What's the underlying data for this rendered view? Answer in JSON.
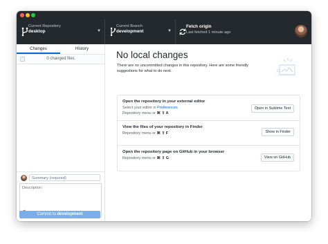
{
  "toolbar": {
    "repo_label": "Current Repository",
    "repo_name": "desktop",
    "branch_label": "Current Branch",
    "branch_name": "development",
    "fetch_title": "Fetch origin",
    "fetch_sub": "Last fetched 1 minute ago"
  },
  "sidebar": {
    "tabs": [
      {
        "label": "Changes"
      },
      {
        "label": "History"
      }
    ],
    "changed_files": "0 changed files"
  },
  "commit": {
    "summary_placeholder": "Summary (required)",
    "description_placeholder": "Description",
    "button_prefix": "Commit to ",
    "button_branch": "development"
  },
  "main": {
    "heading": "No local changes",
    "subtext": "There are no uncommitted changes in this repository. Here are some friendly suggestions for what to do next.",
    "suggestions": [
      {
        "title": "Open the repository in your external editor",
        "sub_prefix": "Select your editor in ",
        "sub_link": "Preferences",
        "key_prefix": "Repository menu or",
        "keys": "⌘ ⇧ A",
        "button": "Open in Sublime Text"
      },
      {
        "title": "View the files of your repository in Finder",
        "key_prefix": "Repository menu or",
        "keys": "⌘ ⇧ F",
        "button": "Show in Finder"
      },
      {
        "title": "Open the repository page on GitHub in your browser",
        "key_prefix": "Repository menu or",
        "keys": "⌘ ⇧ G",
        "button": "View on GitHub"
      }
    ]
  },
  "colors": {
    "toolbar_bg": "#24292e",
    "accent": "#0366d6",
    "commit_button": "#7aaeea"
  },
  "icons": [
    "close-dot",
    "minimize-dot",
    "zoom-dot",
    "repo-icon",
    "branch-icon",
    "sync-icon",
    "caret-down-icon",
    "coauthor-icon"
  ]
}
